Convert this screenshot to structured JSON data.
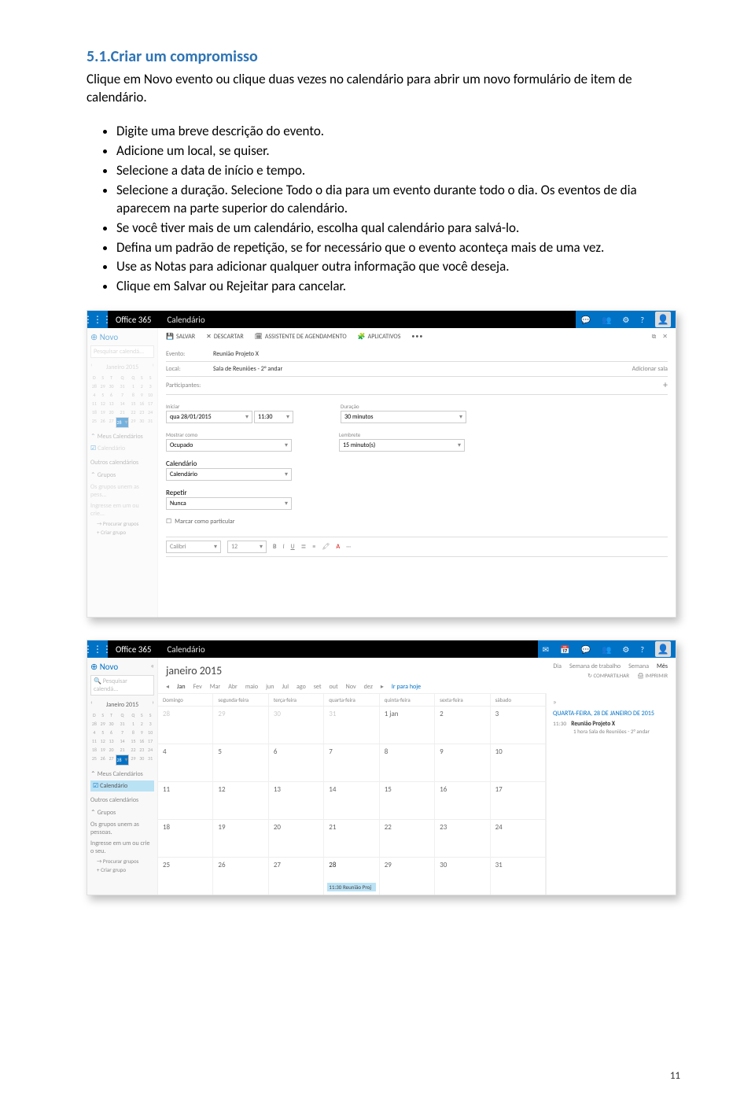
{
  "doc": {
    "heading": "5.1.Criar um compromisso",
    "intro": "Clique em Novo evento ou clique duas vezes no calendário para abrir um novo formulário de item de calendário.",
    "bullets": [
      "Digite uma breve descrição do evento.",
      "Adicione um local, se quiser.",
      "Selecione a data de início e tempo.",
      "Selecione a duração. Selecione Todo o dia para um evento durante todo o dia. Os eventos de dia aparecem na parte superior do calendário.",
      "Se você tiver mais de um calendário, escolha qual calendário para salvá-lo.",
      "Defina um padrão de repetição, se for necessário que o evento aconteça mais de uma vez.",
      "Use as Notas para adicionar qualquer outra informação que você deseja.",
      "Clique em Salvar ou Rejeitar para cancelar."
    ],
    "page_number": "11"
  },
  "app": {
    "brand": "Office 365",
    "module": "Calendário"
  },
  "shot1": {
    "sidebar": {
      "new": "⊕ Novo",
      "search_placeholder": "Pesquisar calendá...",
      "month": "Janeiro 2015",
      "my_cals": "Meus Calendários",
      "calendar_item": "Calendário",
      "other_cals": "Outros calendários",
      "groups": "Grupos",
      "groups_hint": "Os grupos unem as pess...",
      "groups_hint2": "Ingresse em um ou crie...",
      "find_groups": "Procurar grupos",
      "create_group": "Criar grupo"
    },
    "toolbar": {
      "save": "SALVAR",
      "discard": "DESCARTAR",
      "sched": "ASSISTENTE DE AGENDAMENTO",
      "apps": "APLICATIVOS",
      "more": "•••"
    },
    "form": {
      "event_label": "Evento:",
      "event_value": "Reunião Projeto X",
      "location_label": "Local:",
      "location_value": "Sala de Reuniões - 2° andar",
      "add_room": "Adicionar sala",
      "participants_label": "Participantes:",
      "start_label": "Iniciar",
      "start_date": "qua 28/01/2015",
      "start_time": "11:30",
      "duration_label": "Duração",
      "duration_value": "30 minutos",
      "showas_label": "Mostrar como",
      "showas_value": "Ocupado",
      "reminder_label": "Lembrete",
      "reminder_value": "15 minuto(s)",
      "calendar_label": "Calendário",
      "calendar_value": "Calendário",
      "repeat_label": "Repetir",
      "repeat_value": "Nunca",
      "private": "Marcar como particular",
      "font": "Calibri",
      "font_size": "12"
    }
  },
  "shot2": {
    "sidebar": {
      "new": "⊕ Novo",
      "search_placeholder": "Pesquisar calendá...",
      "month": "Janeiro 2015",
      "my_cals": "Meus Calendários",
      "calendar_item": "Calendário",
      "other_cals": "Outros calendários",
      "groups": "Grupos",
      "groups_hint": "Os grupos unem as pessoas.",
      "groups_hint2": "Ingresse em um ou crie o seu.",
      "find_groups": "Procurar grupos",
      "create_group": "Criar grupo"
    },
    "header": {
      "title": "janeiro 2015",
      "months": [
        "Jan",
        "Fev",
        "Mar",
        "Abr",
        "maio",
        "jun",
        "Jul",
        "ago",
        "set",
        "out",
        "Nov",
        "dez"
      ],
      "go_today": "Ir para hoje",
      "views": {
        "day": "Dia",
        "workweek": "Semana de trabalho",
        "week": "Semana",
        "month": "Mês"
      },
      "share": "COMPARTILHAR",
      "print": "IMPRIMIR"
    },
    "grid": {
      "weekdays": [
        "Domingo",
        "segunda-feira",
        "terça-feira",
        "quarta-feira",
        "quinta-feira",
        "sexta-feira",
        "sábado"
      ],
      "rows": [
        [
          "28",
          "29",
          "30",
          "31",
          "1 jan",
          "2",
          "3"
        ],
        [
          "4",
          "5",
          "6",
          "7",
          "8",
          "9",
          "10"
        ],
        [
          "11",
          "12",
          "13",
          "14",
          "15",
          "16",
          "17"
        ],
        [
          "18",
          "19",
          "20",
          "21",
          "22",
          "23",
          "24"
        ],
        [
          "25",
          "26",
          "27",
          "28",
          "29",
          "30",
          "31"
        ]
      ],
      "event": {
        "time": "11:30",
        "title": "Reunião Proj"
      }
    },
    "day_panel": {
      "date": "QUARTA-FEIRA, 28 DE JANEIRO DE 2015",
      "time": "11:30",
      "title": "Reunião Projeto X",
      "sub": "1 hora  Sala de Reuniões - 2° andar"
    }
  }
}
